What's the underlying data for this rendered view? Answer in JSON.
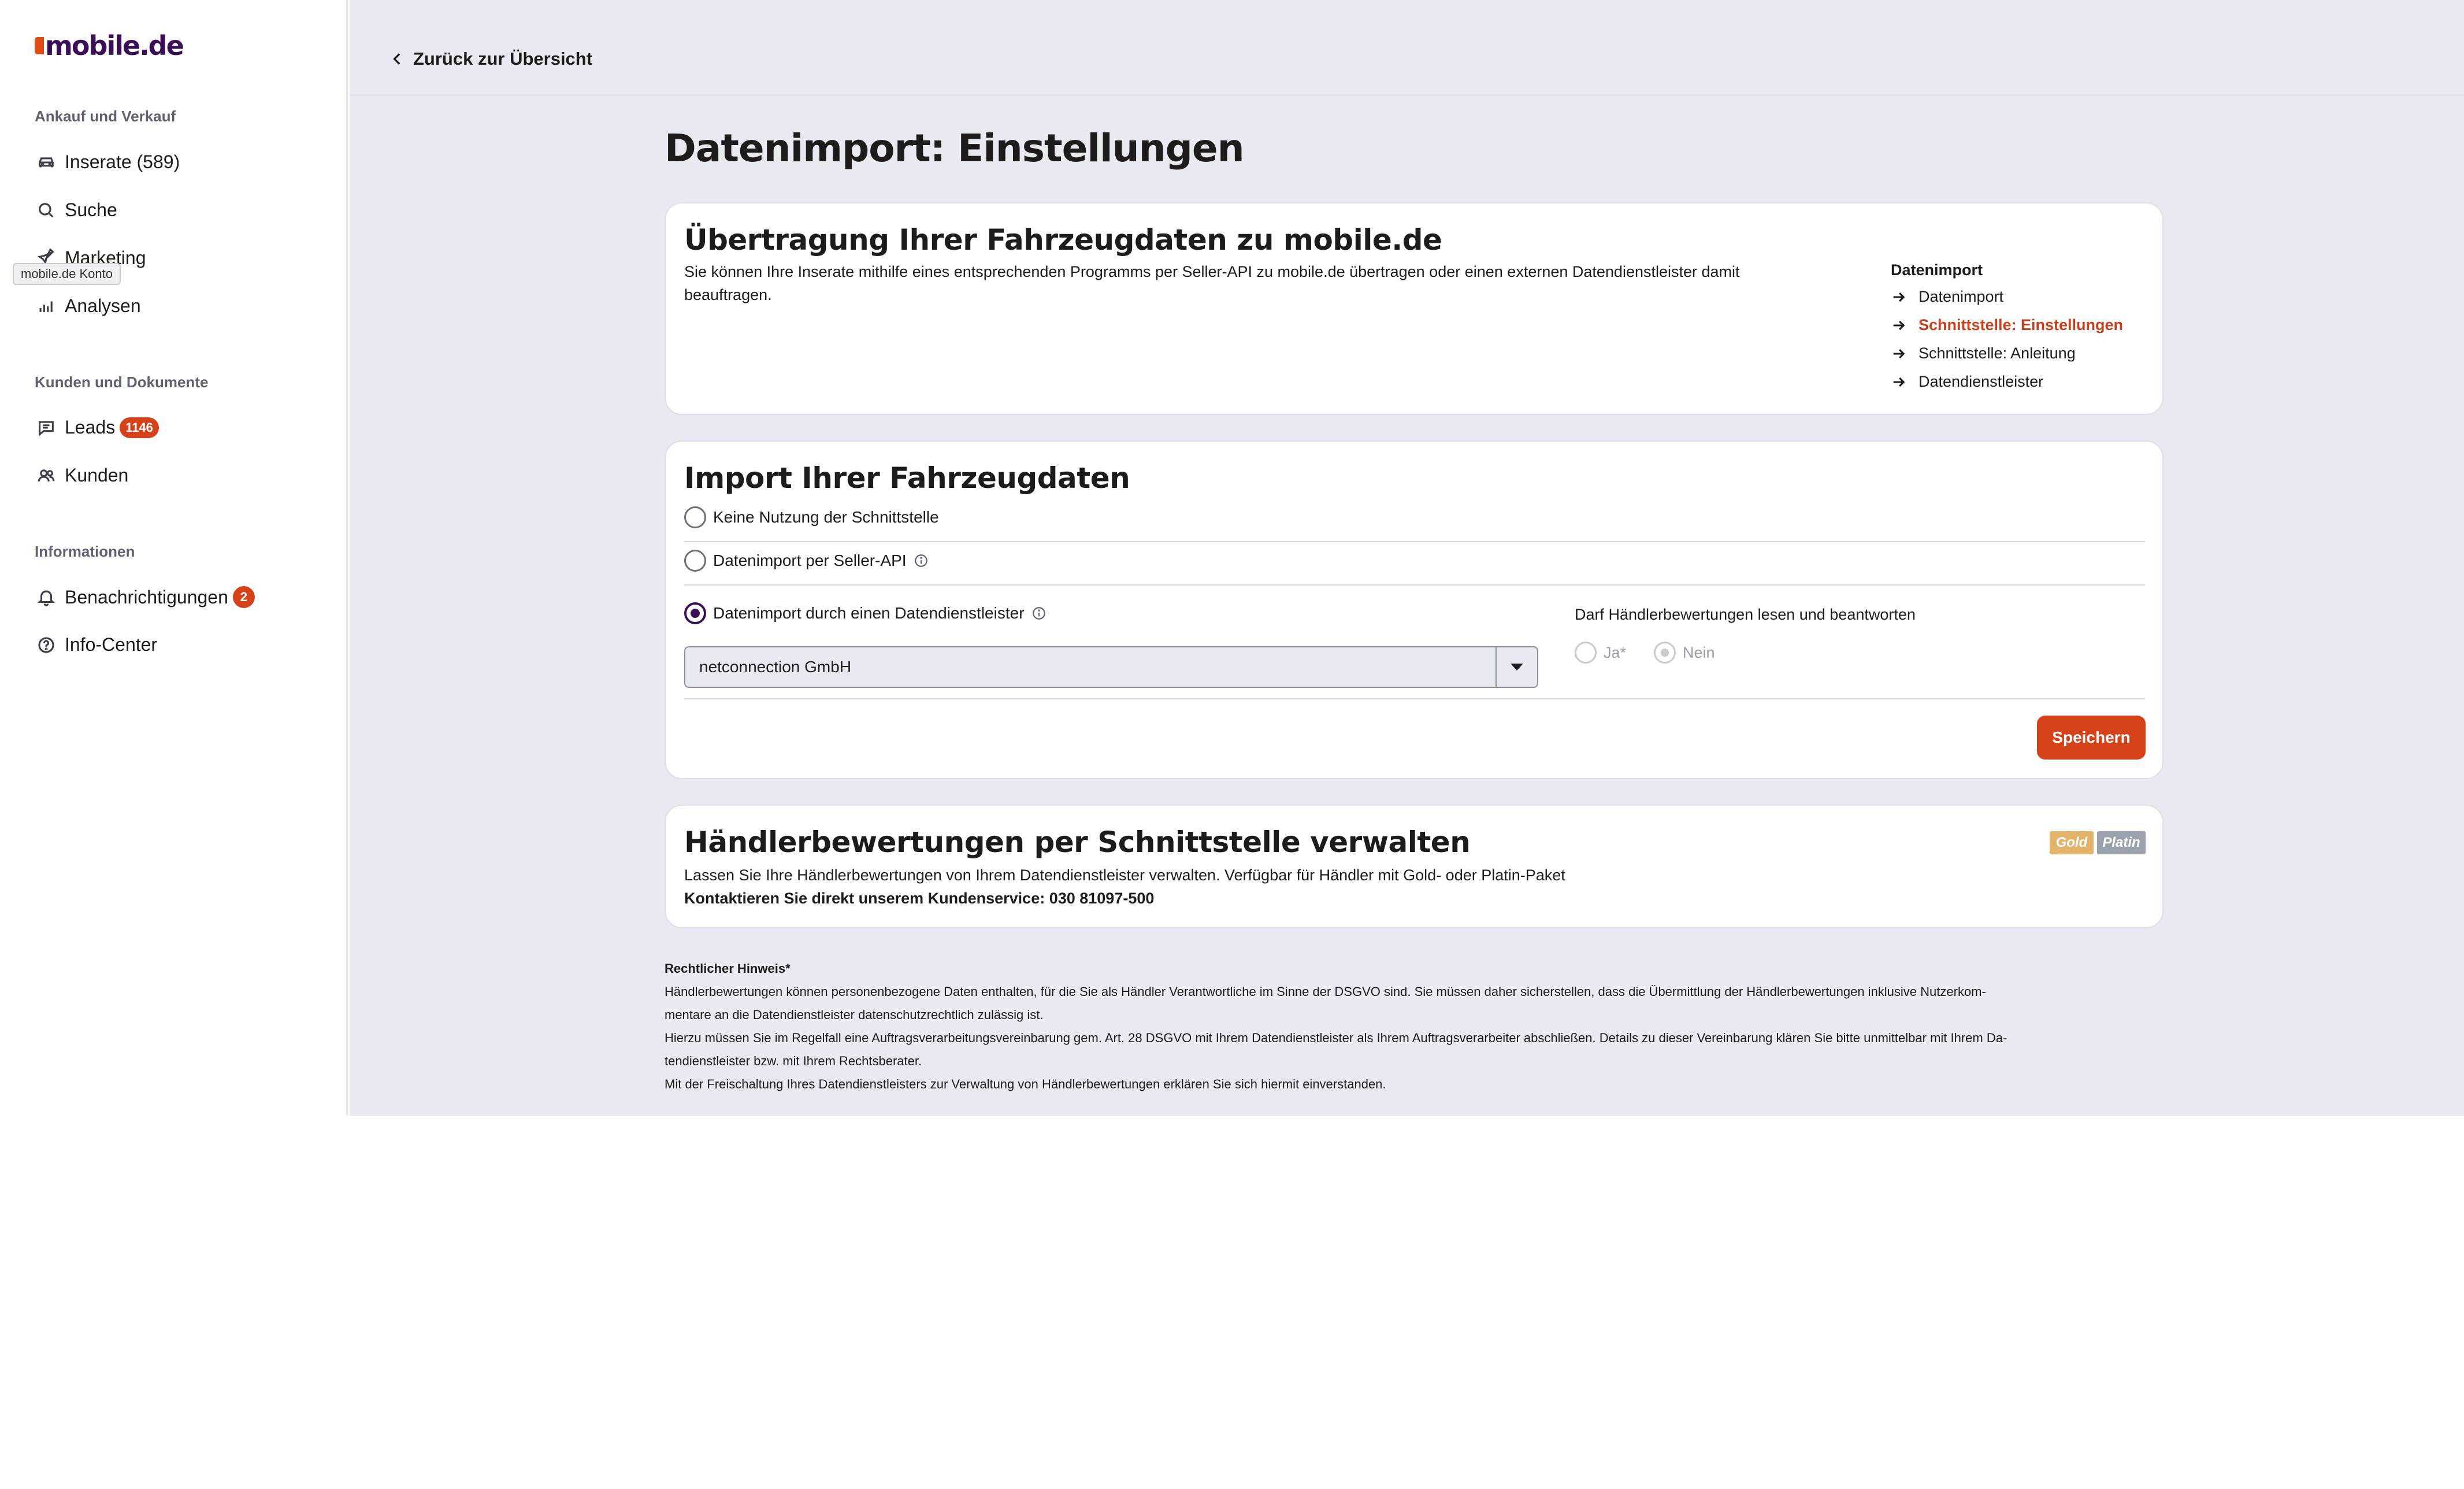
{
  "brand": {
    "logo_text": "mobile.de",
    "logo_color": "#3b0f55",
    "accent_color": "#d5421a"
  },
  "sidebar": {
    "sections": [
      {
        "title": "Ankauf und Verkauf"
      },
      {
        "title": "Kunden und Dokumente"
      },
      {
        "title": "Informationen"
      }
    ],
    "items": [
      {
        "label": "Inserate (589)",
        "icon": "car-icon"
      },
      {
        "label": "Suche",
        "icon": "search-icon"
      },
      {
        "label": "Marketing",
        "icon": "rocket-icon"
      },
      {
        "label": "Analysen",
        "icon": "bar-chart-icon"
      },
      {
        "label": "Leads",
        "icon": "chat-icon",
        "badge": "1146"
      },
      {
        "label": "Kunden",
        "icon": "users-icon"
      },
      {
        "label": "Benachrichtigungen",
        "icon": "bell-icon",
        "badge": "2"
      },
      {
        "label": "Info-Center",
        "icon": "help-icon"
      }
    ],
    "tooltip": "mobile.de Konto"
  },
  "header": {
    "back_label": "Zurück zur Übersicht"
  },
  "page": {
    "title": "Datenimport: Einstellungen"
  },
  "transfer_card": {
    "title": "Übertragung Ihrer Fahrzeugdaten zu mobile.de",
    "text_line1": "Sie können Ihre Inserate mithilfe eines entsprechenden Programms per Seller-API zu mobile.de übertragen oder einen externen Datendienstleister damit",
    "text_line2": "beauftragen.",
    "nav_title": "Datenimport",
    "nav_items": [
      {
        "label": "Datenimport",
        "active": false
      },
      {
        "label": "Schnittstelle: Einstellungen",
        "active": true
      },
      {
        "label": "Schnittstelle: Anleitung",
        "active": false
      },
      {
        "label": "Datendienstleister",
        "active": false
      }
    ]
  },
  "import_card": {
    "title": "Import Ihrer Fahrzeugdaten",
    "options": [
      {
        "label": "Keine Nutzung der Schnittstelle",
        "checked": false
      },
      {
        "label": "Datenimport per Seller-API",
        "checked": false
      },
      {
        "label": "Datenimport durch einen Datendienstleister",
        "checked": true
      }
    ],
    "provider_select_value": "netconnection GmbH",
    "ratings_label": "Darf Händlerbewertungen lesen und beantworten",
    "ratings_yes": "Ja*",
    "ratings_no": "Nein",
    "save_label": "Speichern"
  },
  "ratings_card": {
    "title": "Händlerbewertungen per Schnittstelle verwalten",
    "tag_gold": "Gold",
    "tag_platin": "Platin",
    "text": "Lassen Sie Ihre Händlerbewertungen von Ihrem Datendienstleister verwalten. Verfügbar für Händler mit Gold- oder Platin-Paket",
    "contact": "Kontaktieren Sie direkt unserem Kundenservice: 030 81097-500"
  },
  "legal": {
    "title": "Rechtlicher Hinweis*",
    "lines": [
      "Händlerbewertungen können personenbezogene Daten enthalten, für die Sie als Händler Verantwortliche im Sinne der DSGVO sind. Sie müssen daher sicherstellen, dass die Übermittlung der Händlerbewertungen inklusive Nutzerkom-",
      "mentare an die Datendienstleister datenschutzrechtlich zulässig ist.",
      "Hierzu müssen Sie im Regelfall eine Auftragsverarbeitungsvereinbarung gem. Art. 28 DSGVO mit Ihrem Datendienstleister als Ihrem Auftragsverarbeiter abschließen. Details zu dieser Vereinbarung klären Sie bitte unmittelbar mit Ihrem Da-",
      "tendienstleister bzw. mit Ihrem Rechtsberater.",
      "Mit der Freischaltung Ihres Datendienstleisters zur Verwaltung von Händlerbewertungen erklären Sie sich hiermit einverstanden."
    ]
  }
}
